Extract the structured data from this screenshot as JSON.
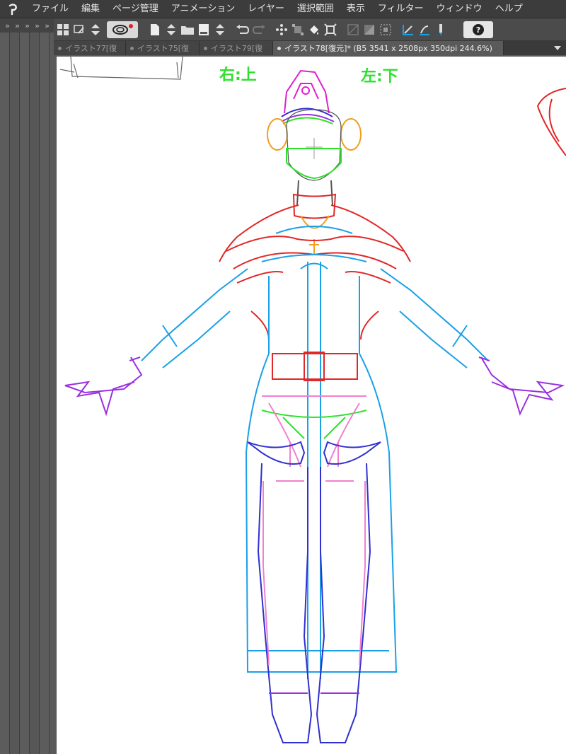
{
  "menu": {
    "items": [
      "ファイル",
      "編集",
      "ページ管理",
      "アニメーション",
      "レイヤー",
      "選択範囲",
      "表示",
      "フィルター",
      "ウィンドウ",
      "ヘルプ"
    ]
  },
  "palette_strip": {
    "arrows": "»»»»»"
  },
  "tabs": [
    {
      "label": "イラスト77[復"
    },
    {
      "label": "イラスト75[復"
    },
    {
      "label": "イラスト79[復"
    },
    {
      "label": "イラスト78[復元]* (B5 3541 x 2508px 350dpi 244.6%)"
    }
  ],
  "canvas": {
    "note_right": "右:上",
    "note_left": "左:下"
  },
  "colors": {
    "outline_blue": "#1aa0e8",
    "red": "#e02828",
    "magenta": "#e020d0",
    "purple": "#9a30e0",
    "green": "#2ee02e",
    "orange": "#f0a020",
    "pink": "#f080d0",
    "dark_blue": "#3030d0"
  },
  "icons": [
    "grid-icon",
    "brush-icon",
    "up-down-icon",
    "lasso-icon",
    "new-file-icon",
    "open-folder-icon",
    "save-icon",
    "undo-icon",
    "redo-icon",
    "scatter-icon",
    "transform-icon",
    "fill-icon",
    "crop-icon",
    "help-icon"
  ]
}
